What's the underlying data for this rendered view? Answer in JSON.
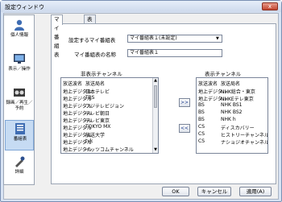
{
  "window": {
    "title": "設定ウィンドウ",
    "close_label": "x"
  },
  "sidebar": {
    "items": [
      {
        "label": "個人情報",
        "icon": "person-icon",
        "selected": false
      },
      {
        "label": "表示／操作",
        "icon": "display-icon",
        "selected": false
      },
      {
        "label": "録画／再生／予約",
        "icon": "record-icon",
        "selected": false
      },
      {
        "label": "番組表",
        "icon": "guide-icon",
        "selected": true
      },
      {
        "label": "詳細",
        "icon": "detail-icon",
        "selected": false
      }
    ]
  },
  "tabs": [
    {
      "label": "マイ番組表"
    },
    {
      "label": "表示"
    }
  ],
  "form": {
    "set_label": "設定するマイ番組表",
    "set_value": "マイ番組表１(未設定)",
    "name_label": "マイ番組表の名称",
    "name_value": "マイ番組表１"
  },
  "hidden_channels": {
    "title": "非表示チャンネル",
    "col_type": "放送波名",
    "col_station": "放送局名",
    "rows": [
      {
        "type": "地上デジタル",
        "station": "日本テレビ"
      },
      {
        "type": "地上デジタル",
        "station": "TBS"
      },
      {
        "type": "地上デジタル",
        "station": "フジテレビジョン"
      },
      {
        "type": "地上デジタル",
        "station": "テレビ朝日"
      },
      {
        "type": "地上デジタル",
        "station": "テレビ東京"
      },
      {
        "type": "地上デジタル",
        "station": "TOKYO MX"
      },
      {
        "type": "地上デジタル",
        "station": "放送大学"
      },
      {
        "type": "地上デジタル",
        "station": "tvk"
      },
      {
        "type": "地上デジタル",
        "station": "イッツコムチャンネル"
      }
    ]
  },
  "shown_channels": {
    "title": "表示チャンネル",
    "col_type": "放送波名",
    "col_station": "放送局名",
    "rows": [
      {
        "type": "地上デジタル",
        "station": "NHK総合・東京"
      },
      {
        "type": "地上デジタル",
        "station": "NHKEテレ東京"
      },
      {
        "type": "BS",
        "station": "NHK BS1"
      },
      {
        "type": "BS",
        "station": "NHK BS2"
      },
      {
        "type": "BS",
        "station": "NHK h"
      },
      {
        "type": "CS",
        "station": "ディスカバリー"
      },
      {
        "type": "CS",
        "station": "ヒストリーチャンネル"
      },
      {
        "type": "CS",
        "station": "ナショジオチャンネル"
      }
    ]
  },
  "move_buttons": {
    "add": ">>",
    "remove": "<<"
  },
  "buttons": {
    "ok": "OK",
    "cancel": "キャンセル",
    "apply": "適用(A)"
  },
  "colors": {
    "accent": "#1f3f8f",
    "selection": "#c6dbf3"
  }
}
